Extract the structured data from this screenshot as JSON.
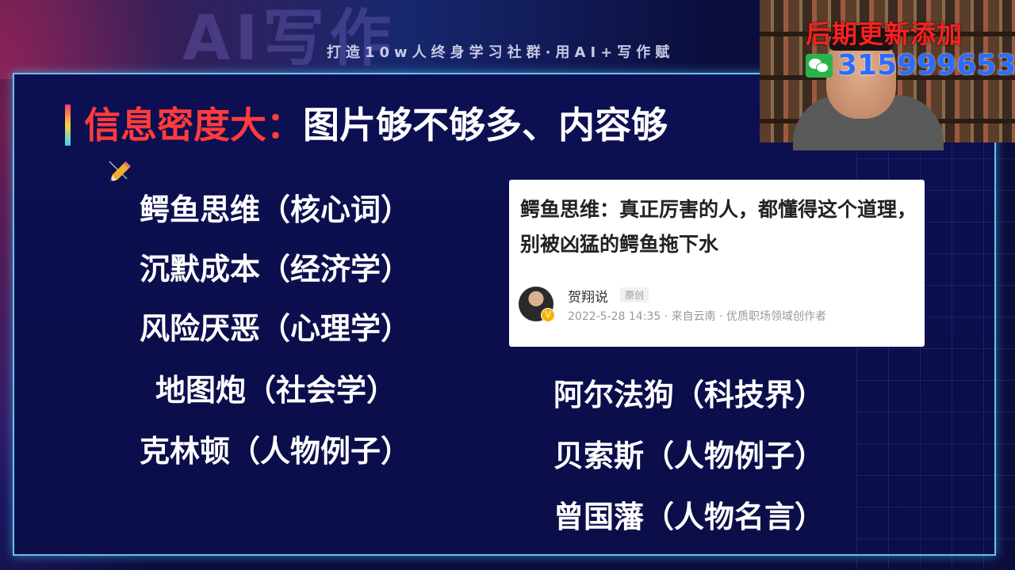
{
  "header": {
    "logo_text": "AI写作",
    "slogan": "打造10w人终身学习社群·用AI+写作赋"
  },
  "title": {
    "highlight": "信息密度大：",
    "rest": "图片够不够多、内容够"
  },
  "left_items": [
    "鳄鱼思维（核心词）",
    "沉默成本（经济学）",
    "风险厌恶（心理学）",
    "地图炮（社会学）",
    "克林顿（人物例子）"
  ],
  "right_items": [
    "阿尔法狗（科技界）",
    "贝索斯（人物例子）",
    "曾国藩（人物名言）"
  ],
  "article_card": {
    "title": "鳄鱼思维：真正厉害的人，都懂得这个道理，别被凶猛的鳄鱼拖下水",
    "author": "贺翔说",
    "badge": "原创",
    "meta": "2022-5-28 14:35 · 来自云南 · 优质职场领域创作者",
    "verified_mark": "V"
  },
  "video_overlay": {
    "caption": "后期更新添加",
    "phone": "315999653"
  },
  "colors": {
    "background": "#0b0d3d",
    "frame_border": "#5ec6f5",
    "title_highlight": "#ff3b3b",
    "overlay_red": "#ff2020",
    "phone_blue": "#2a6cff"
  }
}
